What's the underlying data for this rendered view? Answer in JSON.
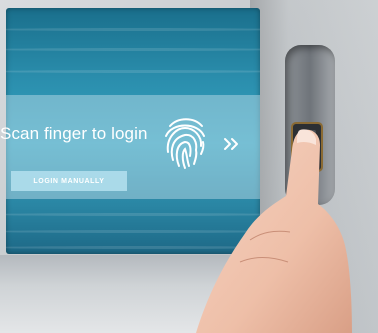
{
  "screen": {
    "prompt": "Scan finger to login",
    "manual_button_label": "LOGIN MANUALLY",
    "fingerprint_icon": "fingerprint-icon",
    "chevron_icon": "chevron-double-right-icon"
  },
  "colors": {
    "screen_sea": "#2b8fae",
    "overlay": "#d2e8f0",
    "button": "#b4e1ee",
    "bezel": "#c6cacd"
  }
}
